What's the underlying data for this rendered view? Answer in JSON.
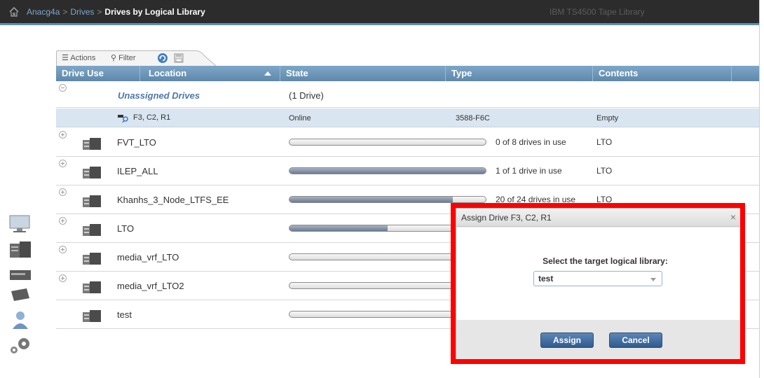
{
  "breadcrumb": {
    "items": [
      "Anacg4a",
      "Drives"
    ],
    "separator": ">",
    "current": "Drives by Logical Library"
  },
  "product_name": "IBM TS4500 Tape Library",
  "toolbar": {
    "actions_label": "Actions",
    "filter_label": "Filter"
  },
  "columns": {
    "drive_use": "Drive Use",
    "location": "Location",
    "state": "State",
    "type": "Type",
    "contents": "Contents"
  },
  "unassigned": {
    "label": "Unassigned Drives",
    "count": "(1 Drive)",
    "drive": {
      "location": "F3, C2, R1",
      "state": "Online",
      "type": "3588-F6C",
      "contents": "Empty"
    }
  },
  "libraries": [
    {
      "name": "FVT_LTO",
      "usage": "0 of 8 drives in use",
      "usage_fraction": 0.0,
      "contents": "LTO"
    },
    {
      "name": "ILEP_ALL",
      "usage": "1 of 1 drive in use",
      "usage_fraction": 1.0,
      "contents": "LTO"
    },
    {
      "name": "Khanhs_3_Node_LTFS_EE",
      "usage": "20 of 24 drives in use",
      "usage_fraction": 0.833,
      "contents": "LTO"
    },
    {
      "name": "LTO",
      "usage": "",
      "usage_fraction": 0.5,
      "contents": ""
    },
    {
      "name": "media_vrf_LTO",
      "usage": "",
      "usage_fraction": 0.0,
      "contents": ""
    },
    {
      "name": "media_vrf_LTO2",
      "usage": "",
      "usage_fraction": 0.0,
      "contents": ""
    },
    {
      "name": "test",
      "usage": "",
      "usage_fraction": 0.0,
      "contents": ""
    }
  ],
  "dialog": {
    "title": "Assign Drive F3, C2, R1",
    "close": "×",
    "prompt": "Select the target logical library:",
    "selected_library": "test",
    "assign_label": "Assign",
    "cancel_label": "Cancel"
  },
  "colors": {
    "topbar": "#2c2c2c",
    "header": "#6f97ba",
    "selected_row": "#d9e5f0",
    "button": "#3f6a9c",
    "highlight": "#ff0000"
  }
}
